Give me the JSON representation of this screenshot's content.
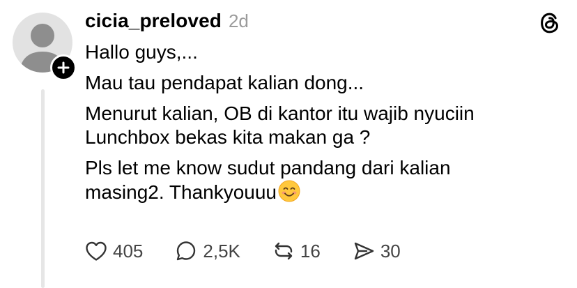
{
  "post": {
    "username": "cicia_preloved",
    "timestamp": "2d",
    "paragraphs": [
      "Hallo guys,...",
      "Mau tau pendapat kalian dong...",
      "Menurut kalian, OB di kantor itu wajib nyuciin",
      "Lunchbox bekas kita makan ga ?",
      "Pls let me know sudut pandang dari kalian",
      "masing2. Thankyouuu"
    ],
    "emoji": "smiling-face-emoji"
  },
  "actions": {
    "likes": "405",
    "comments": "2,5K",
    "reposts": "16",
    "shares": "30"
  },
  "icons": {
    "avatar": "default-avatar-icon",
    "follow": "plus-icon",
    "logo": "threads-logo-icon",
    "like": "heart-icon",
    "comment": "comment-bubble-icon",
    "repost": "repost-icon",
    "share": "send-icon"
  },
  "colors": {
    "text": "#000000",
    "muted": "#9b9b9b",
    "count": "#444444",
    "thread_line": "#e6e6e6",
    "avatar_bg": "#e2e2e2",
    "avatar_fg": "#8e8e8e"
  }
}
